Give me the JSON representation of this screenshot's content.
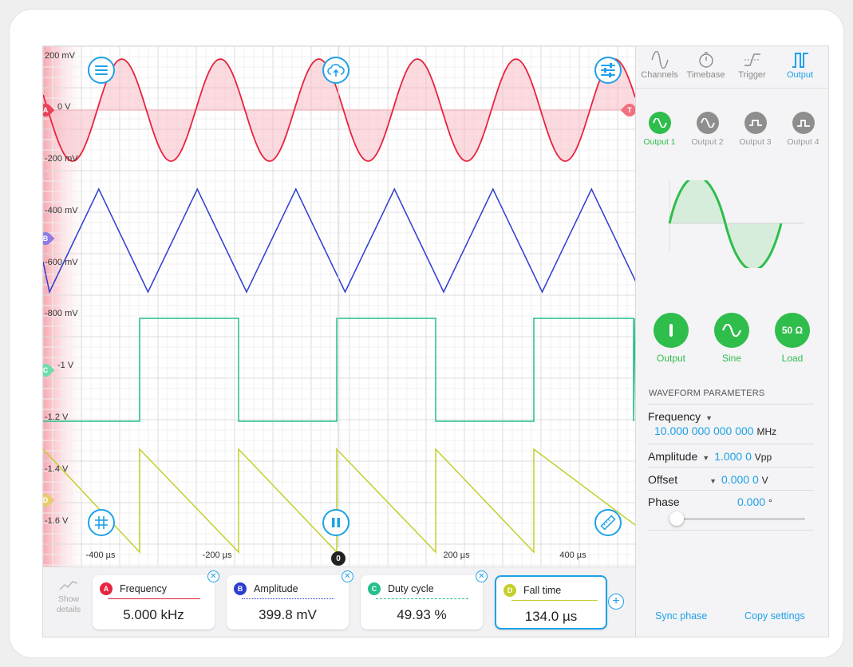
{
  "scope": {
    "y_labels": [
      "200 mV",
      "0 V",
      "-200 mV",
      "-400 mV",
      "-600 mV",
      "-800 mV",
      "-1 V",
      "-1.2 V",
      "-1.4 V",
      "-1.6 V"
    ],
    "x_labels": [
      "-400 µs",
      "-200 µs",
      "200 µs",
      "400 µs"
    ],
    "zero_badge": "0",
    "channel_markers": [
      {
        "label": "A",
        "color": "#e8435a"
      },
      {
        "label": "B",
        "color": "#8f7be6"
      },
      {
        "label": "C",
        "color": "#6ddcae"
      },
      {
        "label": "D",
        "color": "#e8cc6e"
      }
    ],
    "trigger_marker": "T",
    "colors": {
      "A": "#e8243f",
      "B": "#2d3ecf",
      "C": "#22c08a",
      "D": "#c4cf2a",
      "accent": "#1ea1e8"
    }
  },
  "tabs": [
    {
      "label": "Channels",
      "icon": "sine-wave-icon"
    },
    {
      "label": "Timebase",
      "icon": "stopwatch-icon"
    },
    {
      "label": "Trigger",
      "icon": "trigger-edge-icon"
    },
    {
      "label": "Output",
      "icon": "square-pulse-icon",
      "active": true
    }
  ],
  "outputs": [
    {
      "label": "Output 1",
      "icon": "sine-icon",
      "active": true
    },
    {
      "label": "Output 2",
      "icon": "sine-icon"
    },
    {
      "label": "Output 3",
      "icon": "square-icon"
    },
    {
      "label": "Output 4",
      "icon": "pulse-icon"
    }
  ],
  "controls": {
    "output_label": "Output",
    "sine_label": "Sine",
    "load_label": "Load",
    "load_value": "50 Ω"
  },
  "params": {
    "section_title": "WAVEFORM PARAMETERS",
    "frequency_label": "Frequency",
    "frequency_value": "10.000 000 000 000",
    "frequency_unit": "MHz",
    "amplitude_label": "Amplitude",
    "amplitude_value": "1.000 0",
    "amplitude_unit": "Vpp",
    "offset_label": "Offset",
    "offset_value": "0.000 0",
    "offset_unit": "V",
    "phase_label": "Phase",
    "phase_value": "0.000",
    "phase_unit": "°",
    "phase_slider_level": 0
  },
  "links": {
    "sync_phase": "Sync phase",
    "copy_settings": "Copy settings"
  },
  "measurements": {
    "show_details": "Show details",
    "cards": [
      {
        "badge": "A",
        "label": "Frequency",
        "value": "5.000 kHz",
        "color": "#e8243f"
      },
      {
        "badge": "B",
        "label": "Amplitude",
        "value": "399.8 mV",
        "color": "#2d3ecf"
      },
      {
        "badge": "C",
        "label": "Duty cycle",
        "value": "49.93 %",
        "color": "#22c08a"
      },
      {
        "badge": "D",
        "label": "Fall time",
        "value": "134.0 µs",
        "color": "#c4cf2a",
        "selected": true
      }
    ]
  }
}
